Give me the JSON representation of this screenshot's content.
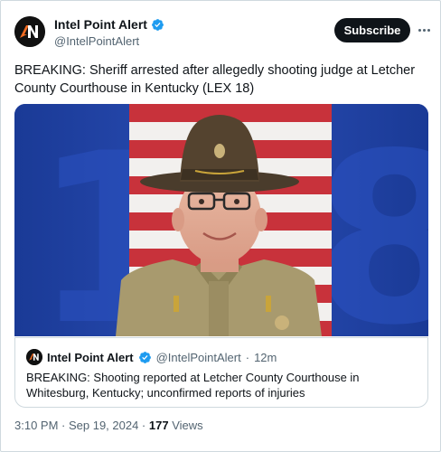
{
  "account": {
    "display_name": "Intel Point Alert",
    "handle": "@IntelPointAlert",
    "subscribe_label": "Subscribe"
  },
  "tweet": {
    "text": "BREAKING: Sheriff arrested after allegedly shooting judge at Letcher County Courthouse in Kentucky (LEX 18)"
  },
  "quote": {
    "display_name": "Intel Point Alert",
    "handle": "@IntelPointAlert",
    "separator": "·",
    "time_ago": "12m",
    "text": "BREAKING: Shooting reported at Letcher County Courthouse in Whitesburg, Kentucky; unconfirmed reports of injuries"
  },
  "meta": {
    "timestamp": "3:10 PM · Sep 19, 2024 ·",
    "views_count": "177",
    "views_label": "Views"
  },
  "colors": {
    "verified": "#1d9bf0",
    "brand_orange": "#f26b21",
    "photo_blue": "#1f3f9e",
    "subscribe_bg": "#0f1419"
  },
  "icons": [
    "verified-badge-icon",
    "more-options-icon",
    "intel-point-logo"
  ]
}
